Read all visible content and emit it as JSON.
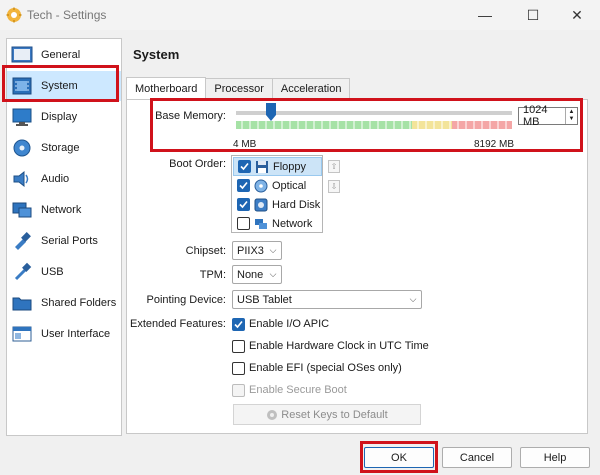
{
  "window": {
    "title": "Tech - Settings",
    "minimize_glyph": "—",
    "maximize_glyph": "☐",
    "close_glyph": "✕"
  },
  "sidebar": {
    "items": [
      {
        "label": "General",
        "icon": "general-icon"
      },
      {
        "label": "System",
        "icon": "system-icon",
        "selected": true
      },
      {
        "label": "Display",
        "icon": "display-icon"
      },
      {
        "label": "Storage",
        "icon": "storage-icon"
      },
      {
        "label": "Audio",
        "icon": "audio-icon"
      },
      {
        "label": "Network",
        "icon": "network-icon"
      },
      {
        "label": "Serial Ports",
        "icon": "serial-ports-icon"
      },
      {
        "label": "USB",
        "icon": "usb-icon"
      },
      {
        "label": "Shared Folders",
        "icon": "shared-folders-icon"
      },
      {
        "label": "User Interface",
        "icon": "user-interface-icon"
      }
    ]
  },
  "main": {
    "title": "System",
    "tabs": [
      {
        "label": "Motherboard",
        "active": true
      },
      {
        "label": "Processor"
      },
      {
        "label": "Acceleration"
      }
    ],
    "base_memory": {
      "label": "Base Memory:",
      "value": "1024 MB",
      "min_label": "4 MB",
      "max_label": "8192 MB",
      "slider_fraction": 0.125
    },
    "boot_order": {
      "label": "Boot Order:",
      "items": [
        {
          "label": "Floppy",
          "checked": true,
          "selected": true
        },
        {
          "label": "Optical",
          "checked": true
        },
        {
          "label": "Hard Disk",
          "checked": true
        },
        {
          "label": "Network",
          "checked": false
        }
      ],
      "up_glyph": "⇧",
      "down_glyph": "⇩"
    },
    "chipset": {
      "label": "Chipset:",
      "value": "PIIX3"
    },
    "tpm": {
      "label": "TPM:",
      "value": "None"
    },
    "pointing_device": {
      "label": "Pointing Device:",
      "value": "USB Tablet"
    },
    "extended_features": {
      "label": "Extended Features:",
      "items": [
        {
          "label": "Enable I/O APIC",
          "checked": true,
          "enabled": true
        },
        {
          "label": "Enable Hardware Clock in UTC Time",
          "checked": false,
          "enabled": true
        },
        {
          "label": "Enable EFI (special OSes only)",
          "checked": false,
          "enabled": true
        },
        {
          "label": "Enable Secure Boot",
          "checked": false,
          "enabled": false
        }
      ]
    },
    "reset_keys_label": "Reset Keys to Default"
  },
  "footer": {
    "ok_label": "OK",
    "cancel_label": "Cancel",
    "help_label": "Help"
  },
  "colors": {
    "highlight_red": "#d0121b",
    "selection_blue": "#cde8ff",
    "checkbox_blue": "#1e66b3"
  }
}
